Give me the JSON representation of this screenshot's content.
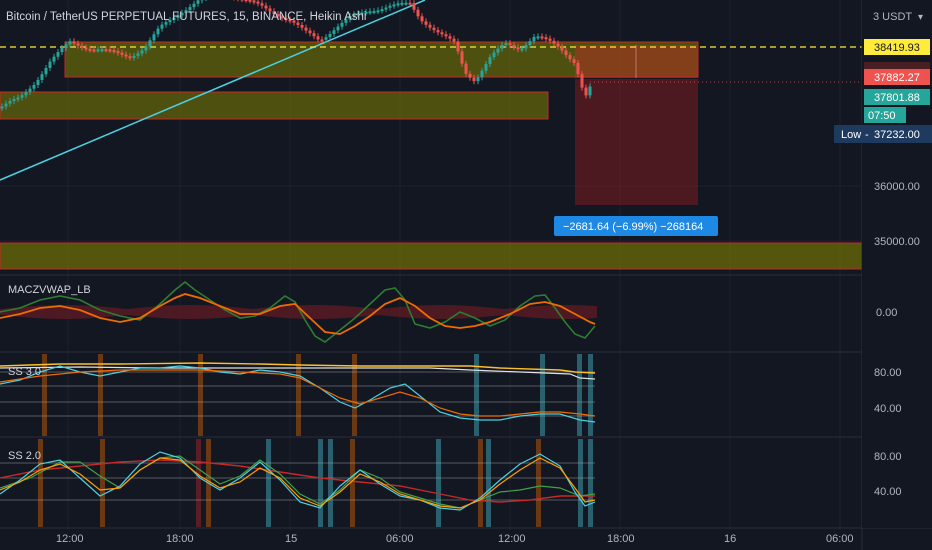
{
  "header": {
    "symbol_title": "Bitcoin / TetherUS PERPETUAL FUTURES, 15, BINANCE, Heikin Ashi",
    "currency": "3 USDT",
    "currency_suffix": "▾"
  },
  "price_axis": {
    "labels": [
      "36000.00",
      "35000.00"
    ],
    "dashed_level": "38419.93",
    "current_price": "37882.27",
    "second_price": "37801.88",
    "countdown": "07:50",
    "low_tag": "Low",
    "low_value": "37232.00"
  },
  "measure_label": "−2681.64 (−6.99%) −268164",
  "indicators": [
    {
      "name": "MACZVWAP_LB",
      "axis_labels": [
        "0.00"
      ]
    },
    {
      "name": "SS 3.0",
      "axis_labels": [
        "80.00",
        "40.00"
      ]
    },
    {
      "name": "SS 2.0",
      "axis_labels": [
        "80.00",
        "40.00"
      ]
    }
  ],
  "time_axis": [
    "12:00",
    "18:00",
    "15",
    "06:00",
    "12:00",
    "18:00",
    "16",
    "06:00"
  ],
  "colors": {
    "background": "#131722",
    "bull": "#26a69a",
    "bear": "#ef5350",
    "zone_fill": "#808000",
    "trendline": "#4dd0e1",
    "dashed": "#ffeb3b",
    "measure": "#2962ff"
  }
}
